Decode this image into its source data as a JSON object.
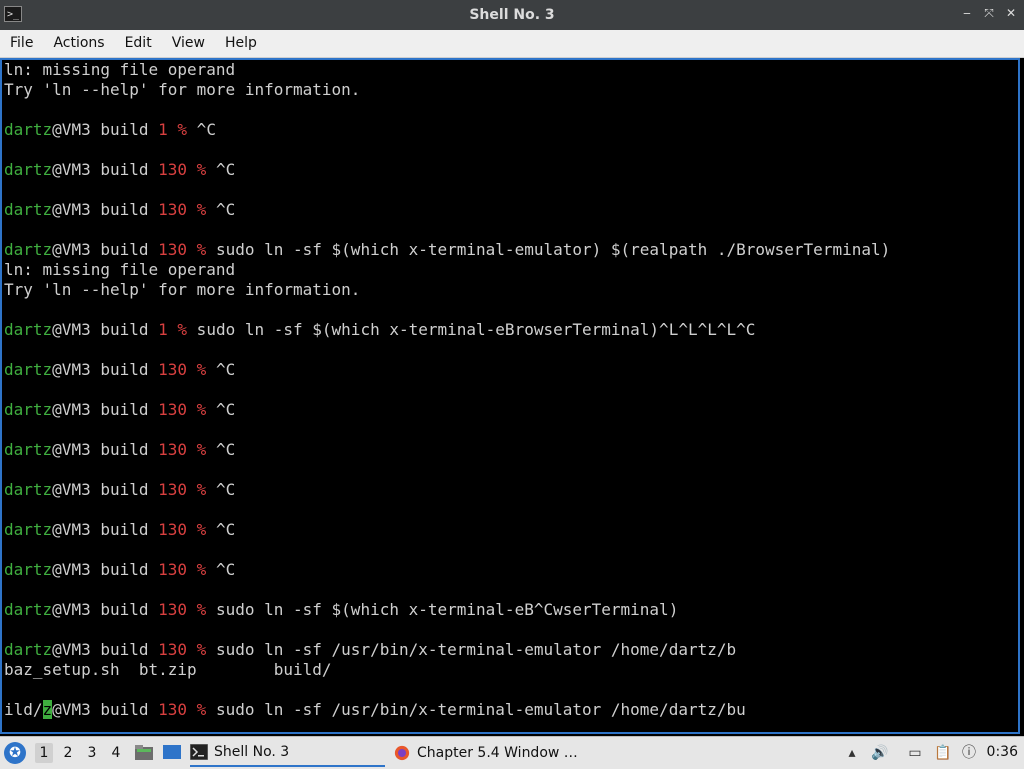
{
  "window": {
    "title": "Shell No. 3",
    "app_icon": "terminal-icon",
    "buttons": [
      "minimize-icon",
      "maximize-icon",
      "close-icon"
    ],
    "minimize_glyph": "‒",
    "maximize_glyph": "⤧",
    "close_glyph": "✕"
  },
  "menu": {
    "items": [
      "File",
      "Actions",
      "Edit",
      "View",
      "Help"
    ]
  },
  "terminal": {
    "colors": {
      "user": "#3fae3f",
      "exit_code": "#d94040",
      "text": "#cfcfcf",
      "background": "#000000"
    },
    "lines": [
      [
        {
          "t": "ln: missing file operand"
        }
      ],
      [
        {
          "t": "Try 'ln --help' for more information."
        }
      ],
      [],
      [
        {
          "t": "dartz",
          "c": "u"
        },
        {
          "t": "@VM3 build "
        },
        {
          "t": "1 %",
          "c": "code"
        },
        {
          "t": " ^C"
        }
      ],
      [],
      [
        {
          "t": "dartz",
          "c": "u"
        },
        {
          "t": "@VM3 build "
        },
        {
          "t": "130 %",
          "c": "code"
        },
        {
          "t": " ^C"
        }
      ],
      [],
      [
        {
          "t": "dartz",
          "c": "u"
        },
        {
          "t": "@VM3 build "
        },
        {
          "t": "130 %",
          "c": "code"
        },
        {
          "t": " ^C"
        }
      ],
      [],
      [
        {
          "t": "dartz",
          "c": "u"
        },
        {
          "t": "@VM3 build "
        },
        {
          "t": "130 %",
          "c": "code"
        },
        {
          "t": " sudo ln -sf $(which x-terminal-emulator) $(realpath ./BrowserTerminal)"
        }
      ],
      [
        {
          "t": "ln: missing file operand"
        }
      ],
      [
        {
          "t": "Try 'ln --help' for more information."
        }
      ],
      [],
      [
        {
          "t": "dartz",
          "c": "u"
        },
        {
          "t": "@VM3 build "
        },
        {
          "t": "1 %",
          "c": "code"
        },
        {
          "t": " sudo ln -sf $(which x-terminal-eBrowserTerminal)^L^L^L^L^C"
        }
      ],
      [],
      [
        {
          "t": "dartz",
          "c": "u"
        },
        {
          "t": "@VM3 build "
        },
        {
          "t": "130 %",
          "c": "code"
        },
        {
          "t": " ^C"
        }
      ],
      [],
      [
        {
          "t": "dartz",
          "c": "u"
        },
        {
          "t": "@VM3 build "
        },
        {
          "t": "130 %",
          "c": "code"
        },
        {
          "t": " ^C"
        }
      ],
      [],
      [
        {
          "t": "dartz",
          "c": "u"
        },
        {
          "t": "@VM3 build "
        },
        {
          "t": "130 %",
          "c": "code"
        },
        {
          "t": " ^C"
        }
      ],
      [],
      [
        {
          "t": "dartz",
          "c": "u"
        },
        {
          "t": "@VM3 build "
        },
        {
          "t": "130 %",
          "c": "code"
        },
        {
          "t": " ^C"
        }
      ],
      [],
      [
        {
          "t": "dartz",
          "c": "u"
        },
        {
          "t": "@VM3 build "
        },
        {
          "t": "130 %",
          "c": "code"
        },
        {
          "t": " ^C"
        }
      ],
      [],
      [
        {
          "t": "dartz",
          "c": "u"
        },
        {
          "t": "@VM3 build "
        },
        {
          "t": "130 %",
          "c": "code"
        },
        {
          "t": " ^C"
        }
      ],
      [],
      [
        {
          "t": "dartz",
          "c": "u"
        },
        {
          "t": "@VM3 build "
        },
        {
          "t": "130 %",
          "c": "code"
        },
        {
          "t": " sudo ln -sf $(which x-terminal-eB^CwserTerminal)"
        }
      ],
      [],
      [
        {
          "t": "dartz",
          "c": "u"
        },
        {
          "t": "@VM3 build "
        },
        {
          "t": "130 %",
          "c": "code"
        },
        {
          "t": " sudo ln -sf /usr/bin/x-terminal-emulator /home/dartz/b"
        }
      ],
      [
        {
          "t": "baz_setup.sh  bt.zip        build/"
        }
      ],
      [],
      [
        {
          "t": "ild/"
        },
        {
          "t": "z",
          "c": "cursor"
        },
        {
          "t": "@VM3 build "
        },
        {
          "t": "130 %",
          "c": "code"
        },
        {
          "t": " sudo ln -sf /usr/bin/x-terminal-emulator /home/dartz/bu"
        }
      ]
    ]
  },
  "taskbar": {
    "start_icon": "start-menu-icon",
    "start_glyph": "✪",
    "workspaces": [
      "1",
      "2",
      "3",
      "4"
    ],
    "active_workspace": "1",
    "quicklaunch": [
      "file-manager-icon",
      "show-desktop-icon"
    ],
    "tasks": [
      {
        "label": "Shell No. 3",
        "icon": "terminal-icon",
        "active": true
      },
      {
        "label": "Chapter 5.4 Window …",
        "icon": "firefox-icon",
        "active": false
      }
    ],
    "tray": [
      {
        "icon": "tray-up-icon",
        "glyph": "▴"
      },
      {
        "icon": "volume-icon",
        "glyph": "🔊"
      },
      {
        "icon": "network-icon",
        "glyph": "▭"
      },
      {
        "icon": "clipboard-icon",
        "glyph": "📋"
      },
      {
        "icon": "notification-icon",
        "glyph": "ⓘ"
      }
    ],
    "clock": "0:36"
  }
}
